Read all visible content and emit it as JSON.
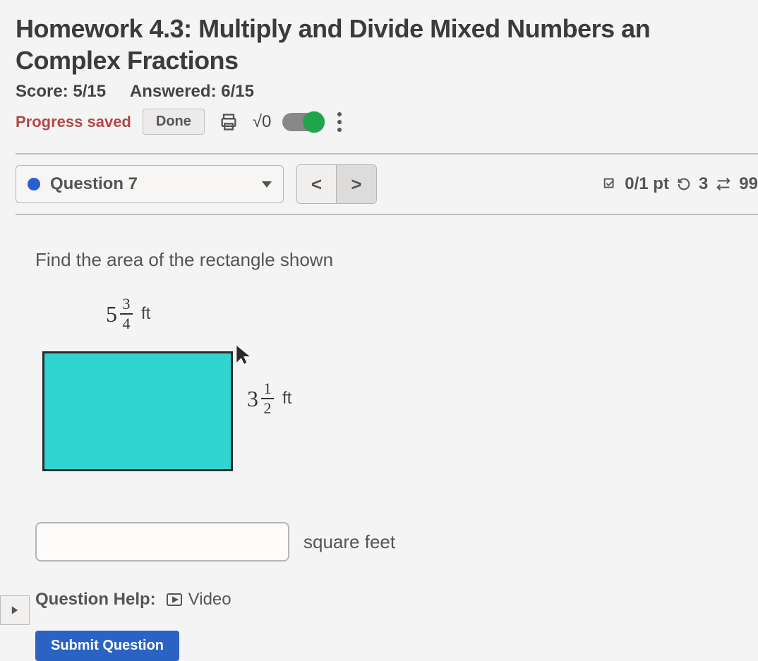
{
  "header": {
    "title": "Homework 4.3: Multiply and Divide Mixed Numbers an Complex Fractions",
    "score_label": "Score: 5/15",
    "answered_label": "Answered: 6/15",
    "progress_saved": "Progress saved",
    "done_label": "Done",
    "sqrt_label": "√0"
  },
  "question_nav": {
    "current_label": "Question 7",
    "prev": "<",
    "next": ">",
    "points": "0/1 pt",
    "retries": "3",
    "attempts": "99"
  },
  "question": {
    "prompt": "Find the area of the rectangle shown",
    "width_whole": "5",
    "width_num": "3",
    "width_den": "4",
    "width_unit": "ft",
    "height_whole": "3",
    "height_num": "1",
    "height_den": "2",
    "height_unit": "ft",
    "answer_unit": "square feet",
    "answer_value": ""
  },
  "help": {
    "label": "Question Help:",
    "video": "Video"
  },
  "submit": {
    "label": "Submit Question"
  }
}
